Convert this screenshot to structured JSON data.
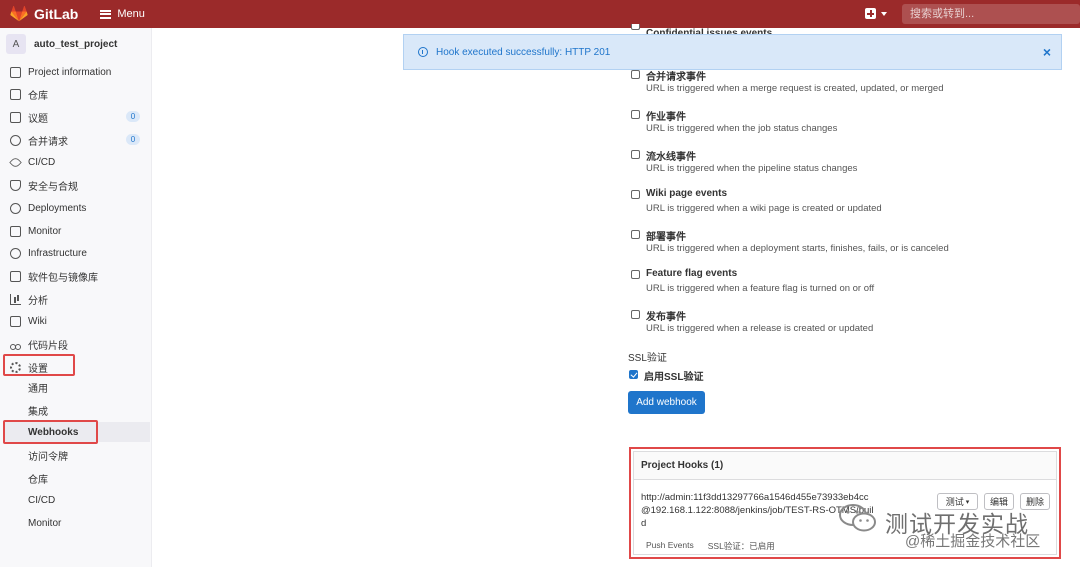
{
  "topbar": {
    "brand": "GitLab",
    "menu_label": "Menu",
    "search_placeholder": "搜索或转到..."
  },
  "sidebar": {
    "project_initial": "A",
    "project_name": "auto_test_project",
    "items": [
      {
        "label": "Project information",
        "icon": "info-icon"
      },
      {
        "label": "仓库",
        "icon": "document-icon"
      },
      {
        "label": "议题",
        "icon": "issues-icon",
        "badge": "0"
      },
      {
        "label": "合并请求",
        "icon": "merge-request-icon",
        "badge": "0"
      },
      {
        "label": "CI/CD",
        "icon": "rocket-icon"
      },
      {
        "label": "安全与合规",
        "icon": "shield-icon"
      },
      {
        "label": "Deployments",
        "icon": "deployments-icon"
      },
      {
        "label": "Monitor",
        "icon": "monitor-icon"
      },
      {
        "label": "Infrastructure",
        "icon": "cloud-icon"
      },
      {
        "label": "软件包与镜像库",
        "icon": "package-icon"
      },
      {
        "label": "分析",
        "icon": "chart-icon"
      },
      {
        "label": "Wiki",
        "icon": "book-icon"
      },
      {
        "label": "代码片段",
        "icon": "scissors-icon"
      },
      {
        "label": "设置",
        "icon": "gear-icon"
      }
    ],
    "settings_sub": [
      "通用",
      "集成",
      "Webhooks",
      "访问令牌",
      "仓库",
      "CI/CD",
      "Monitor"
    ]
  },
  "flash": {
    "message": "Hook executed successfully: HTTP 201",
    "close": "×"
  },
  "events": {
    "cut_label": "Confidential issues events",
    "list": [
      {
        "title": "合并请求事件",
        "desc": "URL is triggered when a merge request is created, updated, or merged"
      },
      {
        "title": "作业事件",
        "desc": "URL is triggered when the job status changes"
      },
      {
        "title": "流水线事件",
        "desc": "URL is triggered when the pipeline status changes"
      },
      {
        "title": "Wiki page events",
        "desc": "URL is triggered when a wiki page is created or updated"
      },
      {
        "title": "部署事件",
        "desc": "URL is triggered when a deployment starts, finishes, fails, or is canceled"
      },
      {
        "title": "Feature flag events",
        "desc": "URL is triggered when a feature flag is turned on or off"
      },
      {
        "title": "发布事件",
        "desc": "URL is triggered when a release is created or updated"
      }
    ]
  },
  "ssl": {
    "label": "SSL验证",
    "enable_label": "启用SSL验证",
    "checked": true
  },
  "add_webhook_label": "Add webhook",
  "hooks": {
    "title": "Project Hooks (1)",
    "url": "http://admin:11f3dd13297766a1546d455e73933eb4cc@192.168.1.122:8088/jenkins/job/TEST-RS-OTMS/build",
    "events": "Push Events",
    "ssl_status": "SSL验证：已启用",
    "test_label": "测试",
    "edit_label": "编辑",
    "delete_label": "删除"
  },
  "watermark": {
    "main": "测试开发实战",
    "sub": "@稀土掘金技术社区"
  },
  "colors": {
    "topbar": "#9b2a2a",
    "primary": "#1f75cb",
    "highlight": "#e04848",
    "flash_bg": "#d9e8f9"
  }
}
